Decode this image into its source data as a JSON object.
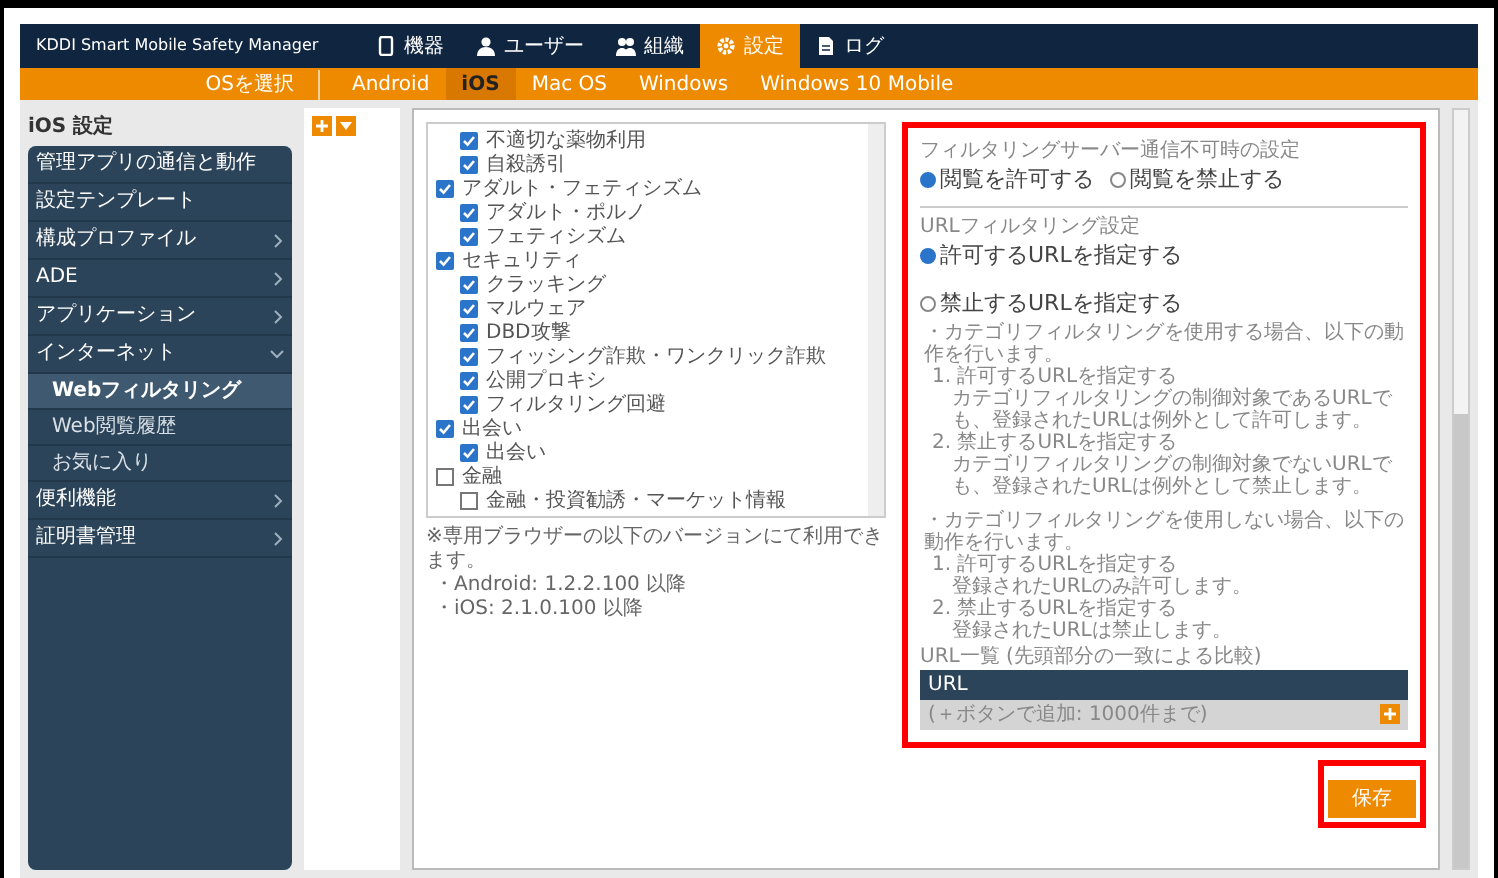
{
  "header": {
    "product": "KDDI Smart Mobile Safety Manager",
    "nav": [
      {
        "label": "機器",
        "selected": false
      },
      {
        "label": "ユーザー",
        "selected": false
      },
      {
        "label": "組織",
        "selected": false
      },
      {
        "label": "設定",
        "selected": true
      },
      {
        "label": "ログ",
        "selected": false
      }
    ]
  },
  "os_bar": {
    "label": "OSを選択",
    "tabs": [
      {
        "label": "Android",
        "selected": false
      },
      {
        "label": "iOS",
        "selected": true
      },
      {
        "label": "Mac OS",
        "selected": false
      },
      {
        "label": "Windows",
        "selected": false
      },
      {
        "label": "Windows 10 Mobile",
        "selected": false
      }
    ]
  },
  "sidebar": {
    "title": "iOS 設定",
    "items": [
      {
        "label": "管理アプリの通信と動作",
        "kind": "plain"
      },
      {
        "label": "設定テンプレート",
        "kind": "plain"
      },
      {
        "label": "構成プロファイル",
        "kind": "collapsed"
      },
      {
        "label": "ADE",
        "kind": "collapsed"
      },
      {
        "label": "アプリケーション",
        "kind": "collapsed"
      },
      {
        "label": "インターネット",
        "kind": "expanded",
        "children": [
          {
            "label": "Webフィルタリング",
            "selected": true
          },
          {
            "label": "Web閲覧履歴",
            "selected": false
          },
          {
            "label": "お気に入り",
            "selected": false
          }
        ]
      },
      {
        "label": "便利機能",
        "kind": "collapsed"
      },
      {
        "label": "証明書管理",
        "kind": "collapsed"
      }
    ]
  },
  "categories": [
    {
      "children": [
        {
          "label": "不適切な薬物利用",
          "checked": true
        },
        {
          "label": "自殺誘引",
          "checked": true
        }
      ]
    },
    {
      "label": "アダルト・フェティシズム",
      "checked": true,
      "children": [
        {
          "label": "アダルト・ポルノ",
          "checked": true
        },
        {
          "label": "フェティシズム",
          "checked": true
        }
      ]
    },
    {
      "label": "セキュリティ",
      "checked": true,
      "children": [
        {
          "label": "クラッキング",
          "checked": true
        },
        {
          "label": "マルウェア",
          "checked": true
        },
        {
          "label": "DBD攻撃",
          "checked": true
        },
        {
          "label": "フィッシング詐欺・ワンクリック詐欺",
          "checked": true
        },
        {
          "label": "公開プロキシ",
          "checked": true
        },
        {
          "label": "フィルタリング回避",
          "checked": true
        }
      ]
    },
    {
      "label": "出会い",
      "checked": true,
      "children": [
        {
          "label": "出会い",
          "checked": true
        }
      ]
    },
    {
      "label": "金融",
      "checked": false,
      "children": [
        {
          "label": "金融・投資勧誘・マーケット情報",
          "checked": false
        }
      ]
    }
  ],
  "browser_note": [
    "※専用ブラウザーの以下のバージョンにて利用できます。",
    "・Android: 1.2.2.100 以降",
    "・iOS: 2.1.0.100 以降"
  ],
  "server_setting": {
    "heading": "フィルタリングサーバー通信不可時の設定",
    "options": [
      {
        "label": "閲覧を許可する",
        "selected": true
      },
      {
        "label": "閲覧を禁止する",
        "selected": false
      }
    ]
  },
  "url_setting": {
    "heading": "URLフィルタリング設定",
    "options": [
      {
        "label": "許可するURLを指定する",
        "selected": true
      },
      {
        "label": "禁止するURLを指定する",
        "selected": false
      }
    ],
    "notes": [
      {
        "kind": "bullet",
        "text": "・カテゴリフィルタリングを使用する場合、以下の動作を行います。"
      },
      {
        "kind": "item",
        "text": "1. 許可するURLを指定する"
      },
      {
        "kind": "detail",
        "text": "カテゴリフィルタリングの制御対象であるURLでも、登録されたURLは例外として許可します。"
      },
      {
        "kind": "item",
        "text": "2. 禁止するURLを指定する"
      },
      {
        "kind": "detail",
        "text": "カテゴリフィルタリングの制御対象でないURLでも、登録されたURLは例外として禁止します。"
      },
      {
        "kind": "bullet",
        "text": "・カテゴリフィルタリングを使用しない場合、以下の動作を行います。"
      },
      {
        "kind": "item",
        "text": "1. 許可するURLを指定する"
      },
      {
        "kind": "detail",
        "text": "登録されたURLのみ許可します。"
      },
      {
        "kind": "item",
        "text": "2. 禁止するURLを指定する"
      },
      {
        "kind": "detail",
        "text": "登録されたURLは禁止します。"
      }
    ]
  },
  "url_list": {
    "heading": "URL一覧 (先頭部分の一致による比較)",
    "columns": [
      "URL"
    ],
    "placeholder_row": "(＋ボタンで追加: 1000件まで)"
  },
  "save_button": "保存"
}
